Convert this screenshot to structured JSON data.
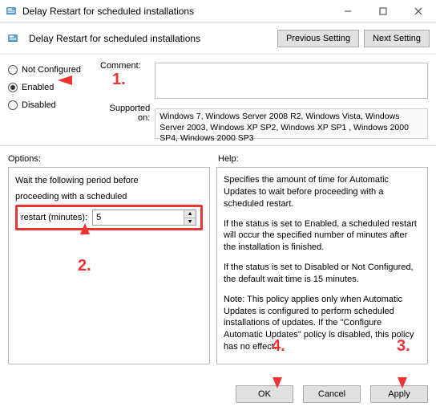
{
  "titlebar": {
    "title": "Delay Restart for scheduled installations"
  },
  "header": {
    "title": "Delay Restart for scheduled installations",
    "prev": "Previous Setting",
    "next": "Next Setting"
  },
  "state": {
    "not_configured": "Not Configured",
    "enabled": "Enabled",
    "disabled": "Disabled"
  },
  "comment": {
    "label": "Comment:"
  },
  "supported": {
    "label": "Supported on:",
    "text": "Windows 7, Windows Server 2008 R2, Windows Vista, Windows Server 2003, Windows XP SP2, Windows XP SP1 , Windows 2000 SP4, Windows 2000 SP3"
  },
  "panes": {
    "options_label": "Options:",
    "help_label": "Help:"
  },
  "options": {
    "wait_line1": "Wait the following period before",
    "wait_line2": "proceeding with a scheduled",
    "restart_label": "restart (minutes):",
    "restart_value": "5"
  },
  "help": {
    "p1": "Specifies the amount of time for Automatic Updates to wait before proceeding with a scheduled restart.",
    "p2": "If the status is set to Enabled, a scheduled restart will occur the specified number of minutes after the installation is finished.",
    "p3": "If the status is set to Disabled or Not Configured, the default wait time is 15 minutes.",
    "p4": "Note: This policy applies only when Automatic Updates is configured to perform scheduled installations of updates. If the \"Configure Automatic Updates\" policy is disabled, this policy has no effect."
  },
  "buttons": {
    "ok": "OK",
    "cancel": "Cancel",
    "apply": "Apply"
  },
  "annotations": {
    "n1": "1.",
    "n2": "2.",
    "n3": "3.",
    "n4": "4."
  }
}
